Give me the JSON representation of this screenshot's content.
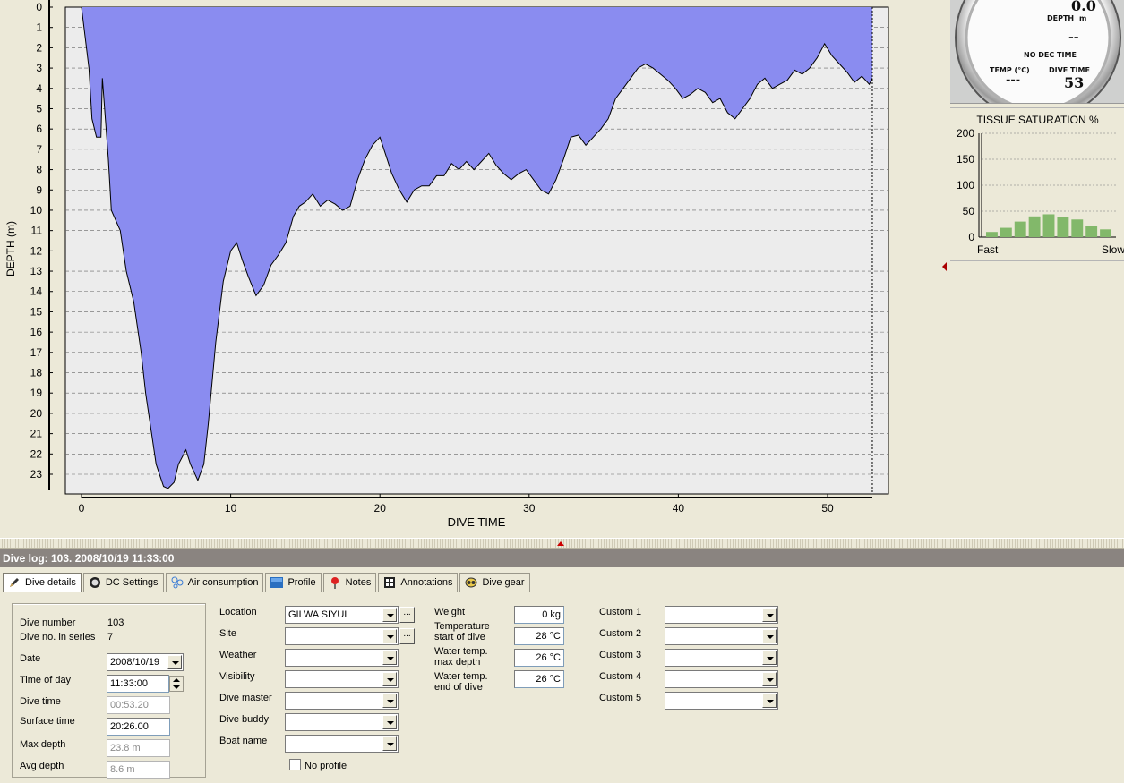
{
  "profile_chart": {
    "type": "area",
    "xlabel": "DIVE TIME",
    "ylabel": "DEPTH (m)",
    "x_ticks": [
      "0",
      "10",
      "20",
      "30",
      "40",
      "50"
    ],
    "y_ticks": [
      "0",
      "1",
      "2",
      "3",
      "4",
      "5",
      "6",
      "7",
      "8",
      "9",
      "10",
      "11",
      "12",
      "13",
      "14",
      "15",
      "16",
      "17",
      "18",
      "19",
      "20",
      "21",
      "22",
      "23"
    ],
    "xlim": [
      0,
      54
    ],
    "ylim": [
      0,
      23.8
    ],
    "fill_color": "#8a8cf0",
    "line_color": "#000000",
    "grid": "horizontal dashed",
    "end_time": 53,
    "x": [
      0,
      0.5,
      0.7,
      1.0,
      1.3,
      1.4,
      1.8,
      2.0,
      2.6,
      3.0,
      3.5,
      4.0,
      4.3,
      5.0,
      5.5,
      5.8,
      6.2,
      6.5,
      7.0,
      7.3,
      7.8,
      8.2,
      8.5,
      9.0,
      9.5,
      10.0,
      10.4,
      10.8,
      11.2,
      11.7,
      12.2,
      12.7,
      13.2,
      13.7,
      14.2,
      14.6,
      15.0,
      15.5,
      16.0,
      16.5,
      17.0,
      17.5,
      18.0,
      18.5,
      19.0,
      19.5,
      20.0,
      20.4,
      20.8,
      21.3,
      21.8,
      22.3,
      22.8,
      23.3,
      23.8,
      24.3,
      24.8,
      25.3,
      25.8,
      26.3,
      26.8,
      27.3,
      27.8,
      28.3,
      28.8,
      29.3,
      29.8,
      30.3,
      30.8,
      31.3,
      31.8,
      32.3,
      32.8,
      33.3,
      33.8,
      34.3,
      34.8,
      35.3,
      35.8,
      36.3,
      36.8,
      37.3,
      37.8,
      38.3,
      38.8,
      39.3,
      39.8,
      40.3,
      40.8,
      41.3,
      41.8,
      42.3,
      42.8,
      43.3,
      43.8,
      44.3,
      44.8,
      45.3,
      45.8,
      46.3,
      46.8,
      47.3,
      47.8,
      48.3,
      48.8,
      49.3,
      49.8,
      50.3,
      50.8,
      51.3,
      51.8,
      52.3,
      52.8,
      53.0
    ],
    "y": [
      0,
      3.0,
      5.5,
      6.4,
      6.4,
      3.5,
      7.5,
      10.0,
      11.0,
      13.0,
      14.5,
      17.0,
      19.0,
      22.5,
      23.6,
      23.7,
      23.4,
      22.5,
      21.8,
      22.5,
      23.3,
      22.5,
      20.5,
      16.5,
      13.5,
      12.0,
      11.6,
      12.5,
      13.3,
      14.2,
      13.7,
      12.7,
      12.2,
      11.6,
      10.3,
      9.8,
      9.6,
      9.2,
      9.8,
      9.5,
      9.7,
      10.0,
      9.8,
      8.5,
      7.5,
      6.8,
      6.4,
      7.3,
      8.2,
      9.0,
      9.6,
      9.0,
      8.8,
      8.8,
      8.3,
      8.3,
      7.7,
      8.0,
      7.6,
      8.0,
      7.6,
      7.2,
      7.8,
      8.2,
      8.5,
      8.2,
      8.0,
      8.5,
      9.0,
      9.2,
      8.5,
      7.5,
      6.4,
      6.3,
      6.8,
      6.4,
      6.0,
      5.5,
      4.5,
      4.0,
      3.5,
      3.0,
      2.8,
      3.0,
      3.3,
      3.6,
      4.0,
      4.5,
      4.3,
      4.0,
      4.2,
      4.7,
      4.5,
      5.2,
      5.5,
      5.0,
      4.5,
      3.8,
      3.5,
      4.0,
      3.8,
      3.6,
      3.1,
      3.3,
      3.0,
      2.5,
      1.8,
      2.4,
      2.8,
      3.2,
      3.7,
      3.4,
      3.8,
      3.5
    ]
  },
  "gauge": {
    "depth_value": "0.0",
    "depth_label": "DEPTH",
    "depth_unit": "m",
    "ndl_value": "--",
    "ndl_label": "NO DEC TIME",
    "temp_label": "TEMP (°C)",
    "temp_value": "---",
    "dive_time_label": "DIVE TIME",
    "dive_time_value": "53"
  },
  "tissue_chart": {
    "type": "bar",
    "title": "TISSUE SATURATION %",
    "y_ticks": [
      "200",
      "150",
      "100",
      "50",
      "0"
    ],
    "ylim": [
      0,
      200
    ],
    "values": [
      10,
      18,
      30,
      40,
      44,
      38,
      34,
      22,
      15
    ],
    "bar_color": "#82b86a",
    "left_label": "Fast",
    "right_label": "Slow"
  },
  "log_title": "Dive log: 103. 2008/10/19 11:33:00",
  "tabs": [
    {
      "label": "Dive details",
      "icon": "pen-icon"
    },
    {
      "label": "DC Settings",
      "icon": "dive-computer-icon"
    },
    {
      "label": "Air consumption",
      "icon": "bubbles-icon"
    },
    {
      "label": "Profile",
      "icon": "profile-chart-icon"
    },
    {
      "label": "Notes",
      "icon": "pushpin-icon"
    },
    {
      "label": "Annotations",
      "icon": "film-icon"
    },
    {
      "label": "Dive gear",
      "icon": "mask-icon"
    }
  ],
  "details": {
    "dive_number_label": "Dive number",
    "dive_number": "103",
    "series_label": "Dive no. in series",
    "series_value": "7",
    "date_label": "Date",
    "date_value": "2008/10/19",
    "time_label": "Time of day",
    "time_value": "11:33:00",
    "dive_time_label": "Dive time",
    "dive_time_value": "00:53.20",
    "surface_label": "Surface time",
    "surface_value": "20:26.00",
    "max_depth_label": "Max depth",
    "max_depth_value": "23.8 m",
    "avg_depth_label": "Avg depth",
    "avg_depth_value": "8.6 m"
  },
  "location": {
    "location_label": "Location",
    "location_value": "GILWA SIYUL",
    "site_label": "Site",
    "weather_label": "Weather",
    "visibility_label": "Visibility",
    "dive_master_label": "Dive master",
    "dive_buddy_label": "Dive buddy",
    "boat_label": "Boat name",
    "no_profile_label": "No profile",
    "ellipsis": "..."
  },
  "conditions": {
    "weight_label": "Weight",
    "weight_value": "0 kg",
    "temp_start_label_1": "Temperature",
    "temp_start_label_2": "start of dive",
    "temp_start_value": "28 °C",
    "temp_max_label_1": "Water temp.",
    "temp_max_label_2": "max depth",
    "temp_max_value": "26 °C",
    "temp_end_label_1": "Water temp.",
    "temp_end_label_2": "end of dive",
    "temp_end_value": "26 °C"
  },
  "custom": {
    "custom1_label": "Custom 1",
    "custom2_label": "Custom 2",
    "custom3_label": "Custom 3",
    "custom4_label": "Custom 4",
    "custom5_label": "Custom 5"
  }
}
